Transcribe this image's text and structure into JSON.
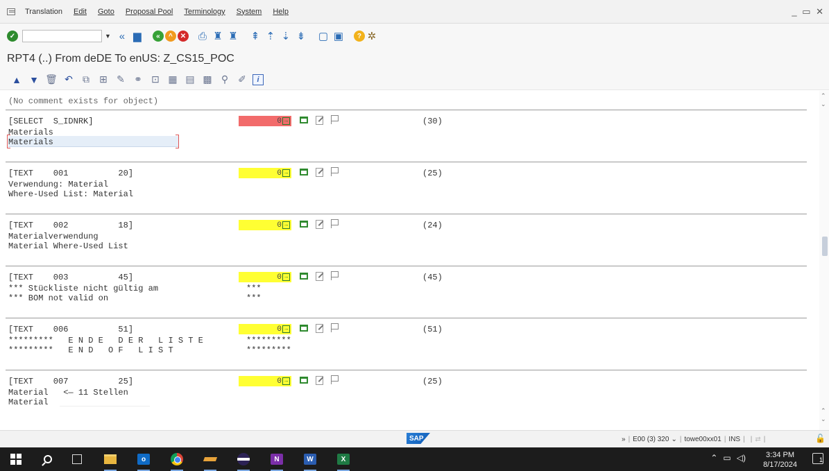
{
  "menu": {
    "items": [
      "Translation",
      "Edit",
      "Goto",
      "Proposal Pool",
      "Terminology",
      "System",
      "Help"
    ]
  },
  "window_controls": "_ ▭ ✕",
  "title": "RPT4 (..) From deDE To enUS: Z_CS15_POC",
  "comment": "(No comment exists for object)",
  "entries": [
    {
      "header": "[SELECT  S_IDNRK]",
      "counter": "0",
      "counter_color": "#f26b6b",
      "length": "(30)",
      "source": "Materials",
      "target": "Materials",
      "extra1": "",
      "extra2": ""
    },
    {
      "header": "[TEXT    001          20]",
      "counter": "0",
      "counter_color": "#ffff33",
      "length": "(25)",
      "source": "Verwendung: Material",
      "target": "Where-Used List: Material",
      "extra1": "",
      "extra2": ""
    },
    {
      "header": "[TEXT    002          18]",
      "counter": "0",
      "counter_color": "#ffff33",
      "length": "(24)",
      "source": "Materialverwendung",
      "target": "Material Where-Used List",
      "extra1": "",
      "extra2": ""
    },
    {
      "header": "[TEXT    003          45]",
      "counter": "0",
      "counter_color": "#ffff33",
      "length": "(45)",
      "source": "*** Stückliste nicht gültig am",
      "target": "*** BOM not valid on",
      "extra1": "***",
      "extra2": "***"
    },
    {
      "header": "[TEXT    006          51]",
      "counter": "0",
      "counter_color": "#ffff33",
      "length": "(51)",
      "source": "*********   E N D E   D E R   L I S T E",
      "target": "*********   E N D   O F   L I S T",
      "extra1": "*********",
      "extra2": "*********"
    },
    {
      "header": "[TEXT    007          25]",
      "counter": "0",
      "counter_color": "#ffff33",
      "length": "(25)",
      "source": "Material   <— 11 Stellen",
      "target": "Material",
      "extra1": "",
      "extra2": ""
    }
  ],
  "status": {
    "logo": "SAP",
    "expand": "»",
    "system": "E00 (3) 320",
    "server": "towe00xx01",
    "mode": "INS"
  },
  "clock": {
    "time": "3:34 PM",
    "date": "8/17/2024"
  },
  "notification_count": "1"
}
